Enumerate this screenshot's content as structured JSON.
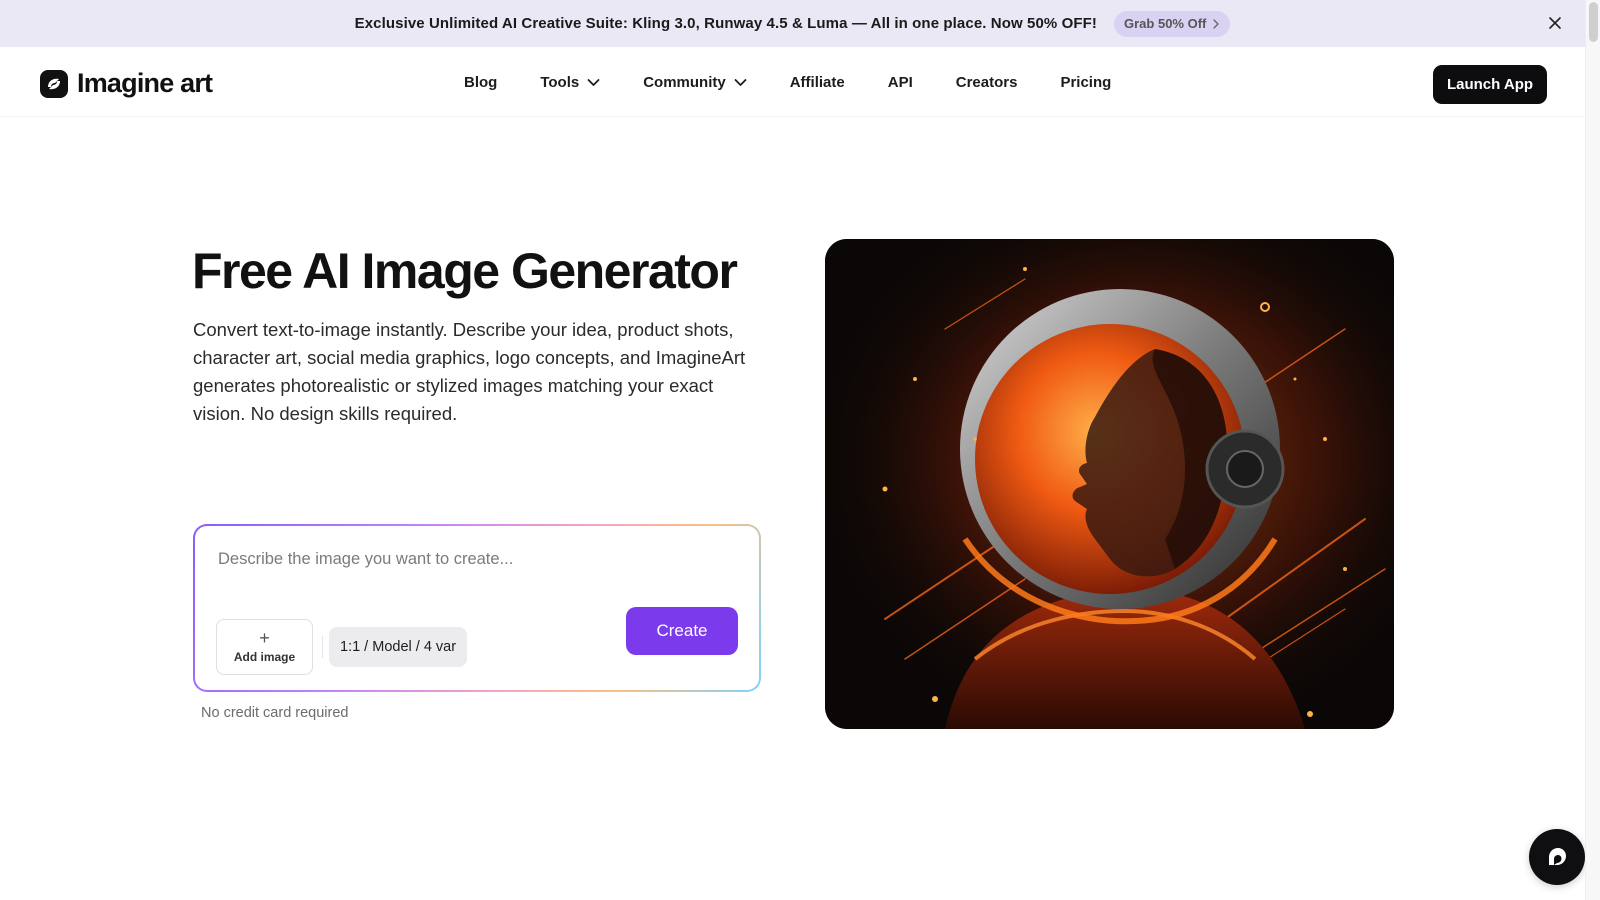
{
  "promo": {
    "text": "Exclusive Unlimited AI Creative Suite: Kling 3.0, Runway 4.5 & Luma — All in one place.  Now 50% OFF!",
    "cta_label": "Grab 50% Off"
  },
  "brand": {
    "name": "Imagine art"
  },
  "nav": {
    "items": [
      {
        "label": "Blog"
      },
      {
        "label": "Tools"
      },
      {
        "label": "Community"
      },
      {
        "label": "Affiliate"
      },
      {
        "label": "API"
      },
      {
        "label": "Creators"
      },
      {
        "label": "Pricing"
      }
    ],
    "launch_label": "Launch App"
  },
  "hero": {
    "title": "Free AI Image Generator",
    "description": "Convert text-to-image instantly. Describe your idea, product shots, character art, social media graphics, logo concepts, and ImagineArt generates photorealistic or stylized images matching your exact vision. No design skills required."
  },
  "prompt": {
    "placeholder": "Describe the image you want to create...",
    "value": "",
    "add_image_label": "Add image",
    "settings_label": "1:1 / Model / 4 var",
    "create_label": "Create",
    "note": "No credit card required"
  },
  "colors": {
    "accent": "#7c3aed",
    "banner_bg": "#ebe8f6",
    "button_dark": "#0d0d0f"
  },
  "icons": {
    "promo_close": "close-icon",
    "promo_chevron": "chevron-right-icon",
    "nav_dropdown": "chevron-down-icon",
    "add_image": "plus-icon",
    "chat": "chat-icon"
  }
}
